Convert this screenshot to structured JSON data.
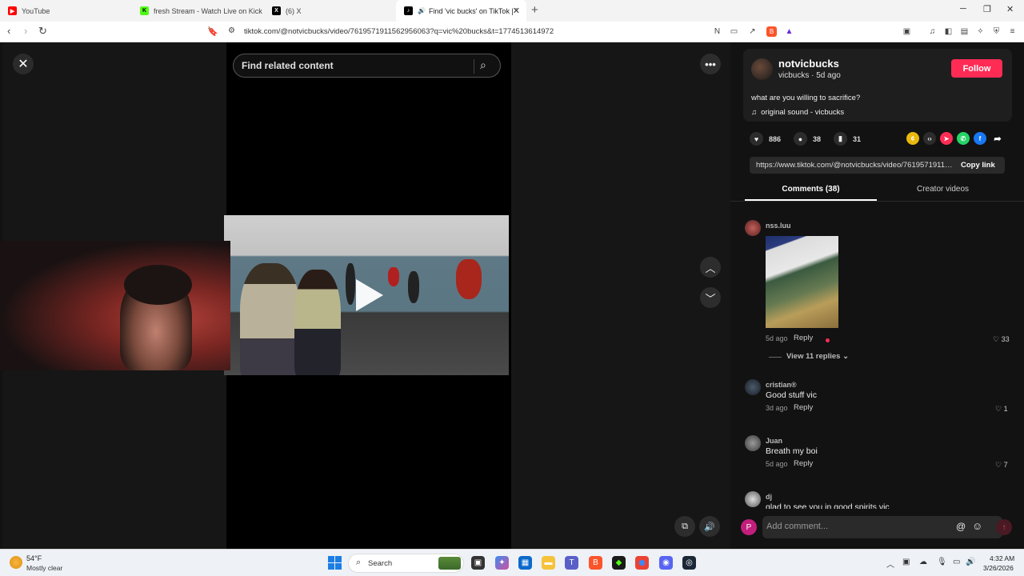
{
  "browser": {
    "tabs": [
      {
        "title": "YouTube",
        "favicon": "youtube-icon",
        "color": "#ff0000"
      },
      {
        "title": "fresh Stream - Watch Live on Kick",
        "favicon": "kick-icon",
        "color": "#53fc18"
      },
      {
        "title": "(6) X",
        "favicon": "x-icon",
        "color": "#000000"
      },
      {
        "title": "Find 'vic bucks' on TikTok | Ti",
        "favicon": "tiktok-icon",
        "color": "#000000"
      }
    ],
    "url": "tiktok.com/@notvicbucks/video/7619571911562956063?q=vic%20bucks&t=1774513614972"
  },
  "video": {
    "search_placeholder": "Find related content"
  },
  "author": {
    "display_name": "notvicbucks",
    "subline": "vicbucks · 5d ago",
    "follow_label": "Follow",
    "caption": "what are you willing to sacrifice?",
    "sound": "original sound - vicbucks"
  },
  "stats": {
    "likes": "886",
    "comments": "38",
    "saves": "31"
  },
  "share": {
    "link": "https://www.tiktok.com/@notvicbucks/video/7619571911562956063",
    "copy_label": "Copy link"
  },
  "tabs": {
    "comments": "Comments (38)",
    "creator": "Creator videos"
  },
  "comments": [
    {
      "user": "nss.luu",
      "time": "5d ago",
      "reply": "Reply",
      "likes": "33"
    },
    {
      "user": "cristian®",
      "text": "Good stuff vic",
      "time": "3d ago",
      "reply": "Reply",
      "likes": "1"
    },
    {
      "user": "Juan",
      "text": "Breath my boi",
      "time": "5d ago",
      "reply": "Reply",
      "likes": "7"
    },
    {
      "user": "dj",
      "text": "glad to see you in good spirits vic"
    }
  ],
  "view_replies": "View 11 replies",
  "comment_box": {
    "avatar_letter": "P",
    "placeholder": "Add comment..."
  },
  "taskbar": {
    "temp": "54°F",
    "weather": "Mostly clear",
    "search": "Search",
    "time": "4:32 AM",
    "date": "3/26/2026"
  },
  "colors": {
    "accent": "#fe2c55",
    "background": "#121212"
  }
}
